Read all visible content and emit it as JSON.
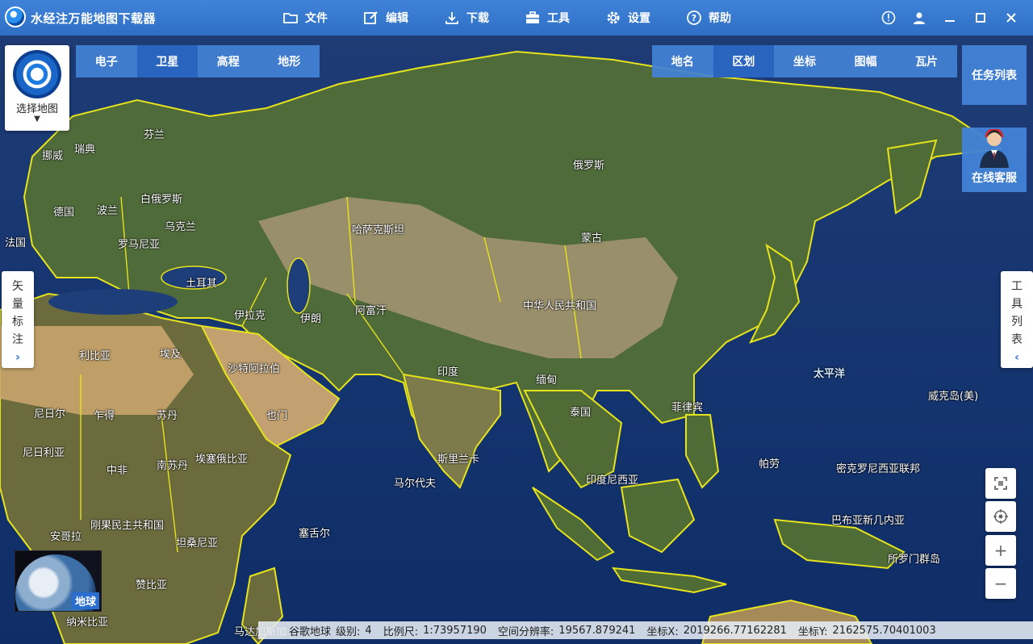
{
  "app": {
    "title": "水经注万能地图下载器",
    "logo_icon": "globe-logo-icon"
  },
  "menu": [
    {
      "label": "文件",
      "icon": "folder-icon"
    },
    {
      "label": "编辑",
      "icon": "edit-icon"
    },
    {
      "label": "下载",
      "icon": "download-icon"
    },
    {
      "label": "工具",
      "icon": "toolbox-icon"
    },
    {
      "label": "设置",
      "icon": "gear-icon"
    },
    {
      "label": "帮助",
      "icon": "help-icon"
    }
  ],
  "window_controls": [
    "info-icon",
    "user-icon",
    "minimize-icon",
    "maximize-icon",
    "close-icon"
  ],
  "map_selector": {
    "label": "选择地图"
  },
  "layer_tabs": {
    "left": [
      "电子",
      "卫星",
      "高程",
      "地形"
    ],
    "left_active": 1,
    "right": [
      "地名",
      "区划",
      "坐标",
      "图幅",
      "瓦片"
    ],
    "right_active": 1
  },
  "task_list": {
    "label": "任务列表"
  },
  "service": {
    "label": "在线客服"
  },
  "side_left": {
    "chars": [
      "矢",
      "量",
      "标",
      "注"
    ],
    "arrow": "›"
  },
  "side_right": {
    "chars": [
      "工",
      "具",
      "列",
      "表"
    ],
    "arrow": "‹"
  },
  "zoom": {
    "plus": "+",
    "minus": "−"
  },
  "globe_thumb": {
    "label": "地球"
  },
  "map_labels": {
    "finland": "芬兰",
    "sweden": "瑞典",
    "norway": "挪威",
    "belarus": "白俄罗斯",
    "germany": "德国",
    "poland": "波兰",
    "france": "法国",
    "ukraine": "乌克兰",
    "romania": "罗马尼亚",
    "turkey": "土耳其",
    "russia": "俄罗斯",
    "kazakhstan": "哈萨克斯坦",
    "mongolia": "蒙古",
    "china": "中华人民共和国",
    "iran": "伊朗",
    "iraq": "伊拉克",
    "afghanistan": "阿富汗",
    "india": "印度",
    "saudi": "沙特阿拉伯",
    "yemen": "也门",
    "libya": "利比亚",
    "egypt": "埃及",
    "niger": "尼日尔",
    "chad": "乍得",
    "sudan": "苏丹",
    "nigeria": "尼日利亚",
    "car": "中非",
    "south_sudan": "南苏丹",
    "ethiopia": "埃塞俄比亚",
    "drc": "刚果民主共和国",
    "tanzania": "坦桑尼亚",
    "angola": "安哥拉",
    "zambia": "赞比亚",
    "namibia": "纳米比亚",
    "madagascar": "马达加斯加",
    "thailand": "泰国",
    "myanmar": "缅甸",
    "philippines": "菲律宾",
    "indonesia": "印度尼西亚",
    "png": "巴布亚新几内亚",
    "palau": "帕劳",
    "micronesia": "密克罗尼西亚联邦",
    "wake": "威克岛(美)",
    "maldives": "马尔代夫",
    "sri_lanka": "斯里兰卡",
    "seychelles": "塞舌尔",
    "solomon": "所罗门群岛",
    "pacific": "太平洋"
  },
  "status": {
    "source": "谷歌地球",
    "level_label": "级别:",
    "level": "4",
    "scale_label": "比例尺:",
    "scale": "1:73957190",
    "resolution_label": "空间分辨率:",
    "resolution": "19567.879241",
    "x_label": "坐标X:",
    "x": "2019266.77162281",
    "y_label": "坐标Y:",
    "y": "2162575.70401003"
  }
}
